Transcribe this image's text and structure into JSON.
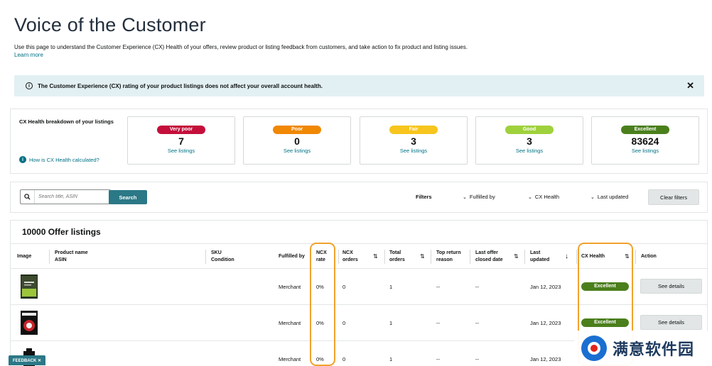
{
  "page": {
    "title": "Voice of the Customer",
    "intro": "Use this page to understand the Customer Experience (CX) Health of your offers, review product or listing feedback from customers, and take action to fix product and listing issues.",
    "learn_more": "Learn more"
  },
  "banner": {
    "message": "The Customer Experience (CX) rating of your product listings does not affect your overall account health.",
    "info_glyph": "i",
    "close_glyph": "✕"
  },
  "health": {
    "heading": "CX Health breakdown of your listings",
    "calc_link": "How is CX Health calculated?",
    "info_glyph": "i",
    "cards": [
      {
        "label": "Very poor",
        "count": "7",
        "link": "See listings",
        "color": "#c40f3b"
      },
      {
        "label": "Poor",
        "count": "0",
        "link": "See listings",
        "color": "#f08804"
      },
      {
        "label": "Fair",
        "count": "3",
        "link": "See listings",
        "color": "#f7c51d"
      },
      {
        "label": "Good",
        "count": "3",
        "link": "See listings",
        "color": "#9fd13c"
      },
      {
        "label": "Excellent",
        "count": "83624",
        "link": "See listings",
        "color": "#4b7f1c"
      }
    ]
  },
  "search": {
    "placeholder": "Search title, ASIN",
    "button": "Search",
    "filters_label": "Filters",
    "filters": [
      "Fulfilled by",
      "CX Health",
      "Last updated"
    ],
    "chevron": "⌄",
    "clear": "Clear filters"
  },
  "listings": {
    "title": "10000 Offer listings",
    "sort_glyph": "⇅",
    "sort_desc_glyph": "↓",
    "headers": {
      "image": "Image",
      "product_name": "Product name",
      "asin": "ASIN",
      "sku": "SKU",
      "condition": "Condition",
      "fulfilled_by": "Fulfilled by",
      "ncx_rate_1": "NCX",
      "ncx_rate_2": "rate",
      "ncx_orders_1": "NCX",
      "ncx_orders_2": "orders",
      "total_orders_1": "Total",
      "total_orders_2": "orders",
      "top_return_1": "Top return",
      "top_return_2": "reason",
      "last_offer_1": "Last offer",
      "last_offer_2": "closed date",
      "last_updated_1": "Last",
      "last_updated_2": "updated",
      "cx_health": "CX Health",
      "action": "Action"
    },
    "rows": [
      {
        "fulfilled_by": "Merchant",
        "ncx_rate": "0%",
        "ncx_orders": "0",
        "total_orders": "1",
        "top_return": "--",
        "last_offer": "--",
        "last_updated": "Jan 12, 2023",
        "cx_health": "Excellent",
        "action": "See details"
      },
      {
        "fulfilled_by": "Merchant",
        "ncx_rate": "0%",
        "ncx_orders": "0",
        "total_orders": "1",
        "top_return": "--",
        "last_offer": "--",
        "last_updated": "Jan 12, 2023",
        "cx_health": "Excellent",
        "action": "See details"
      },
      {
        "fulfilled_by": "Merchant",
        "ncx_rate": "0%",
        "ncx_orders": "0",
        "total_orders": "1",
        "top_return": "--",
        "last_offer": "--",
        "last_updated": "Jan 12, 2023"
      }
    ]
  },
  "feedback": {
    "label": "FEEDBACK ✕"
  },
  "watermark": {
    "text": "满意软件园"
  },
  "colors": {
    "accent": "#2b7886",
    "link": "#007185",
    "highlight": "#f0a22d",
    "banner_bg": "#e3f0f3"
  }
}
